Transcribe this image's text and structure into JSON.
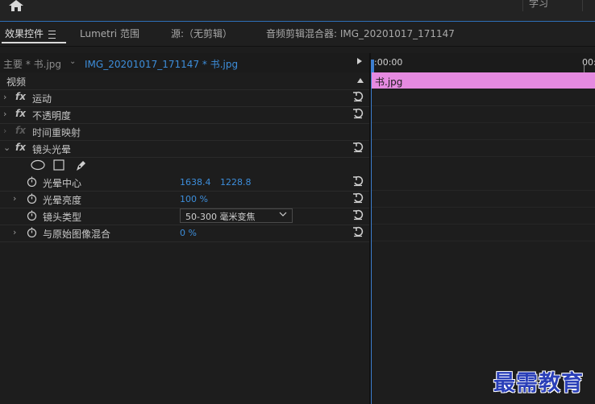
{
  "topbar": {
    "workspace_label": "学习"
  },
  "tabs": [
    {
      "label": "效果控件",
      "active": true
    },
    {
      "label": "Lumetri 范围"
    },
    {
      "label": "源:（无剪辑）"
    },
    {
      "label": "音频剪辑混合器: IMG_20201017_171147"
    }
  ],
  "sequence": {
    "main_label": "主要 * 书.jpg",
    "clip_label": "IMG_20201017_171147 * 书.jpg"
  },
  "effects": {
    "header": "视频",
    "motion": "运动",
    "opacity": "不透明度",
    "time_remap": "时间重映射",
    "lens_flare": "镜头光晕",
    "params": {
      "flare_center": {
        "label": "光晕中心",
        "x": "1638.4",
        "y": "1228.8"
      },
      "flare_brightness": {
        "label": "光晕亮度",
        "value": "100 %"
      },
      "lens_type": {
        "label": "镜头类型",
        "value": "50-300 毫米变焦"
      },
      "blend_original": {
        "label": "与原始图像混合",
        "value": "0 %"
      }
    }
  },
  "timeline": {
    "tc_start": ":00:00",
    "tc_end": "00:",
    "clip_name": "书.jpg"
  },
  "colors": {
    "accent": "#3d8edb",
    "clip": "#e58ae0",
    "watermark": "#2a3fb8"
  },
  "watermark": "最需教育"
}
